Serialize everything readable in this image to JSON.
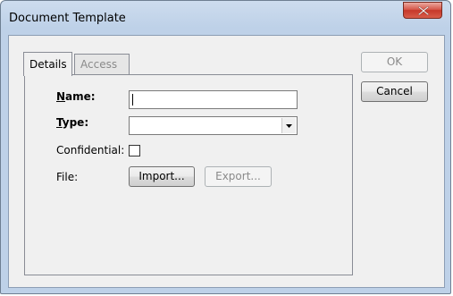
{
  "window": {
    "title": "Document Template",
    "close_icon": "close-x-icon"
  },
  "tabs": [
    {
      "label": "Details",
      "active": true
    },
    {
      "label": "Access",
      "active": false
    }
  ],
  "form": {
    "name_label": "Name:",
    "name_value": "",
    "type_label": "Type:",
    "type_value": "",
    "confidential_label": "Confidential:",
    "confidential_checked": false,
    "file_label": "File:",
    "import_label": "Import...",
    "export_label": "Export..."
  },
  "buttons": {
    "ok_label": "OK",
    "ok_enabled": false,
    "cancel_label": "Cancel"
  },
  "colors": {
    "close_button": "#c6382a",
    "frame": "#bed1e8",
    "client": "#f0f0f0"
  }
}
